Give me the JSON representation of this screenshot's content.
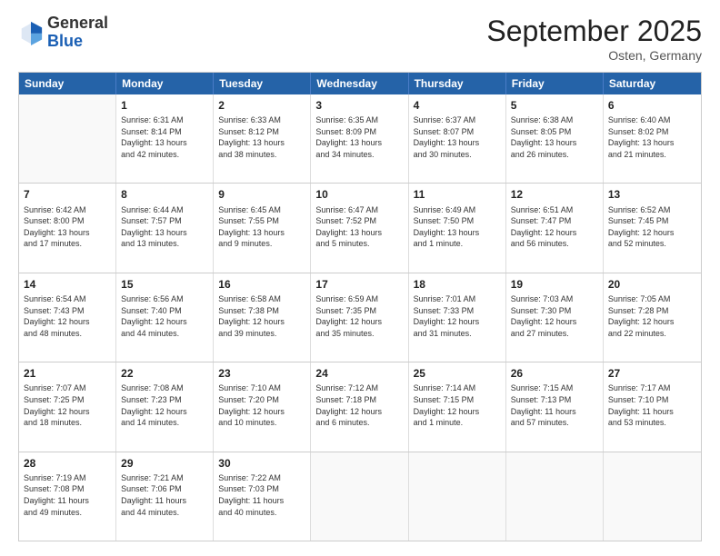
{
  "header": {
    "logo": {
      "line1": "General",
      "line2": "Blue"
    },
    "title": "September 2025",
    "location": "Osten, Germany"
  },
  "weekdays": [
    "Sunday",
    "Monday",
    "Tuesday",
    "Wednesday",
    "Thursday",
    "Friday",
    "Saturday"
  ],
  "rows": [
    [
      {
        "day": "",
        "empty": true,
        "lines": []
      },
      {
        "day": "1",
        "empty": false,
        "lines": [
          "Sunrise: 6:31 AM",
          "Sunset: 8:14 PM",
          "Daylight: 13 hours",
          "and 42 minutes."
        ]
      },
      {
        "day": "2",
        "empty": false,
        "lines": [
          "Sunrise: 6:33 AM",
          "Sunset: 8:12 PM",
          "Daylight: 13 hours",
          "and 38 minutes."
        ]
      },
      {
        "day": "3",
        "empty": false,
        "lines": [
          "Sunrise: 6:35 AM",
          "Sunset: 8:09 PM",
          "Daylight: 13 hours",
          "and 34 minutes."
        ]
      },
      {
        "day": "4",
        "empty": false,
        "lines": [
          "Sunrise: 6:37 AM",
          "Sunset: 8:07 PM",
          "Daylight: 13 hours",
          "and 30 minutes."
        ]
      },
      {
        "day": "5",
        "empty": false,
        "lines": [
          "Sunrise: 6:38 AM",
          "Sunset: 8:05 PM",
          "Daylight: 13 hours",
          "and 26 minutes."
        ]
      },
      {
        "day": "6",
        "empty": false,
        "lines": [
          "Sunrise: 6:40 AM",
          "Sunset: 8:02 PM",
          "Daylight: 13 hours",
          "and 21 minutes."
        ]
      }
    ],
    [
      {
        "day": "7",
        "empty": false,
        "lines": [
          "Sunrise: 6:42 AM",
          "Sunset: 8:00 PM",
          "Daylight: 13 hours",
          "and 17 minutes."
        ]
      },
      {
        "day": "8",
        "empty": false,
        "lines": [
          "Sunrise: 6:44 AM",
          "Sunset: 7:57 PM",
          "Daylight: 13 hours",
          "and 13 minutes."
        ]
      },
      {
        "day": "9",
        "empty": false,
        "lines": [
          "Sunrise: 6:45 AM",
          "Sunset: 7:55 PM",
          "Daylight: 13 hours",
          "and 9 minutes."
        ]
      },
      {
        "day": "10",
        "empty": false,
        "lines": [
          "Sunrise: 6:47 AM",
          "Sunset: 7:52 PM",
          "Daylight: 13 hours",
          "and 5 minutes."
        ]
      },
      {
        "day": "11",
        "empty": false,
        "lines": [
          "Sunrise: 6:49 AM",
          "Sunset: 7:50 PM",
          "Daylight: 13 hours",
          "and 1 minute."
        ]
      },
      {
        "day": "12",
        "empty": false,
        "lines": [
          "Sunrise: 6:51 AM",
          "Sunset: 7:47 PM",
          "Daylight: 12 hours",
          "and 56 minutes."
        ]
      },
      {
        "day": "13",
        "empty": false,
        "lines": [
          "Sunrise: 6:52 AM",
          "Sunset: 7:45 PM",
          "Daylight: 12 hours",
          "and 52 minutes."
        ]
      }
    ],
    [
      {
        "day": "14",
        "empty": false,
        "lines": [
          "Sunrise: 6:54 AM",
          "Sunset: 7:43 PM",
          "Daylight: 12 hours",
          "and 48 minutes."
        ]
      },
      {
        "day": "15",
        "empty": false,
        "lines": [
          "Sunrise: 6:56 AM",
          "Sunset: 7:40 PM",
          "Daylight: 12 hours",
          "and 44 minutes."
        ]
      },
      {
        "day": "16",
        "empty": false,
        "lines": [
          "Sunrise: 6:58 AM",
          "Sunset: 7:38 PM",
          "Daylight: 12 hours",
          "and 39 minutes."
        ]
      },
      {
        "day": "17",
        "empty": false,
        "lines": [
          "Sunrise: 6:59 AM",
          "Sunset: 7:35 PM",
          "Daylight: 12 hours",
          "and 35 minutes."
        ]
      },
      {
        "day": "18",
        "empty": false,
        "lines": [
          "Sunrise: 7:01 AM",
          "Sunset: 7:33 PM",
          "Daylight: 12 hours",
          "and 31 minutes."
        ]
      },
      {
        "day": "19",
        "empty": false,
        "lines": [
          "Sunrise: 7:03 AM",
          "Sunset: 7:30 PM",
          "Daylight: 12 hours",
          "and 27 minutes."
        ]
      },
      {
        "day": "20",
        "empty": false,
        "lines": [
          "Sunrise: 7:05 AM",
          "Sunset: 7:28 PM",
          "Daylight: 12 hours",
          "and 22 minutes."
        ]
      }
    ],
    [
      {
        "day": "21",
        "empty": false,
        "lines": [
          "Sunrise: 7:07 AM",
          "Sunset: 7:25 PM",
          "Daylight: 12 hours",
          "and 18 minutes."
        ]
      },
      {
        "day": "22",
        "empty": false,
        "lines": [
          "Sunrise: 7:08 AM",
          "Sunset: 7:23 PM",
          "Daylight: 12 hours",
          "and 14 minutes."
        ]
      },
      {
        "day": "23",
        "empty": false,
        "lines": [
          "Sunrise: 7:10 AM",
          "Sunset: 7:20 PM",
          "Daylight: 12 hours",
          "and 10 minutes."
        ]
      },
      {
        "day": "24",
        "empty": false,
        "lines": [
          "Sunrise: 7:12 AM",
          "Sunset: 7:18 PM",
          "Daylight: 12 hours",
          "and 6 minutes."
        ]
      },
      {
        "day": "25",
        "empty": false,
        "lines": [
          "Sunrise: 7:14 AM",
          "Sunset: 7:15 PM",
          "Daylight: 12 hours",
          "and 1 minute."
        ]
      },
      {
        "day": "26",
        "empty": false,
        "lines": [
          "Sunrise: 7:15 AM",
          "Sunset: 7:13 PM",
          "Daylight: 11 hours",
          "and 57 minutes."
        ]
      },
      {
        "day": "27",
        "empty": false,
        "lines": [
          "Sunrise: 7:17 AM",
          "Sunset: 7:10 PM",
          "Daylight: 11 hours",
          "and 53 minutes."
        ]
      }
    ],
    [
      {
        "day": "28",
        "empty": false,
        "lines": [
          "Sunrise: 7:19 AM",
          "Sunset: 7:08 PM",
          "Daylight: 11 hours",
          "and 49 minutes."
        ]
      },
      {
        "day": "29",
        "empty": false,
        "lines": [
          "Sunrise: 7:21 AM",
          "Sunset: 7:06 PM",
          "Daylight: 11 hours",
          "and 44 minutes."
        ]
      },
      {
        "day": "30",
        "empty": false,
        "lines": [
          "Sunrise: 7:22 AM",
          "Sunset: 7:03 PM",
          "Daylight: 11 hours",
          "and 40 minutes."
        ]
      },
      {
        "day": "",
        "empty": true,
        "lines": []
      },
      {
        "day": "",
        "empty": true,
        "lines": []
      },
      {
        "day": "",
        "empty": true,
        "lines": []
      },
      {
        "day": "",
        "empty": true,
        "lines": []
      }
    ]
  ]
}
